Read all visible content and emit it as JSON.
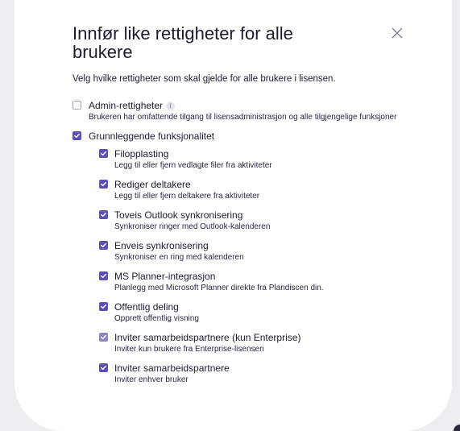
{
  "dialog": {
    "title": "Innfør like rettigheter for alle brukere",
    "subtitle": "Velg hvilke rettigheter som skal gjelde for alle brukere i lisensen.",
    "close_icon": "close-icon"
  },
  "admin": {
    "label": "Admin-rettigheter",
    "description": "Brukeren har omfattende tilgang til lisensadministrasjon og alle tilgjengelige funksjoner",
    "checked": false,
    "info_icon": "i"
  },
  "basic": {
    "label": "Grunnleggende funksjonalitet",
    "checked": true,
    "items": [
      {
        "label": "Filopplasting",
        "description": "Legg til eller fjern vedlagte filer fra aktiviteter",
        "checked": true
      },
      {
        "label": "Rediger deltakere",
        "description": "Legg til eller fjern deltakere fra aktiviteter",
        "checked": true
      },
      {
        "label": "Toveis Outlook synkronisering",
        "description": "Synkroniser ringer med Outlook-kalenderen",
        "checked": true
      },
      {
        "label": "Enveis synkronisering",
        "description": "Synkroniser en ring med kalenderen",
        "checked": true
      },
      {
        "label": "MS Planner-integrasjon",
        "description": "Planlegg med Microsoft Planner direkte fra Plandiscen din.",
        "checked": true
      },
      {
        "label": "Offentlig deling",
        "description": "Opprett offentlig visning",
        "checked": true
      },
      {
        "label": "Inviter samarbeidspartnere (kun Enterprise)",
        "description": "Inviter kun brukere fra Enterprise-lisensen",
        "checked": true,
        "disabled": true
      },
      {
        "label": "Inviter samarbeidspartnere",
        "description": "Inviter enhver bruker",
        "checked": true
      }
    ]
  },
  "colors": {
    "accent": "#5a4fb8",
    "accent_disabled": "#8b84c9",
    "backdrop": "#ededf0"
  }
}
